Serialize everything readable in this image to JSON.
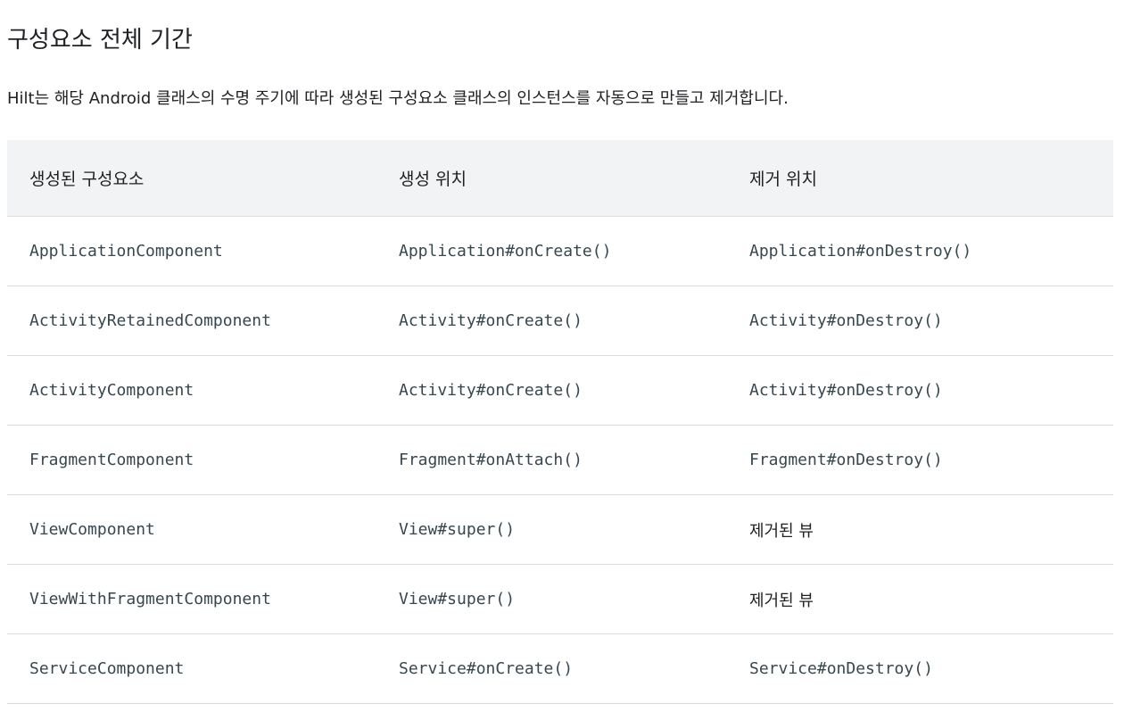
{
  "heading": "구성요소 전체 기간",
  "intro_text": "Hilt는 해당 Android 클래스의 수명 주기에 따라 생성된 구성요소 클래스의 인스턴스를 자동으로 만들고 제거합니다.",
  "table": {
    "headers": [
      "생성된 구성요소",
      "생성 위치",
      "제거 위치"
    ],
    "rows": [
      {
        "component": "ApplicationComponent",
        "created": "Application#onCreate()",
        "destroyed": "Application#onDestroy()"
      },
      {
        "component": "ActivityRetainedComponent",
        "created": "Activity#onCreate()",
        "destroyed": "Activity#onDestroy()"
      },
      {
        "component": "ActivityComponent",
        "created": "Activity#onCreate()",
        "destroyed": "Activity#onDestroy()"
      },
      {
        "component": "FragmentComponent",
        "created": "Fragment#onAttach()",
        "destroyed": "Fragment#onDestroy()"
      },
      {
        "component": "ViewComponent",
        "created": "View#super()",
        "destroyed": "제거된 뷰"
      },
      {
        "component": "ViewWithFragmentComponent",
        "created": "View#super()",
        "destroyed": "제거된 뷰"
      },
      {
        "component": "ServiceComponent",
        "created": "Service#onCreate()",
        "destroyed": "Service#onDestroy()"
      }
    ]
  }
}
